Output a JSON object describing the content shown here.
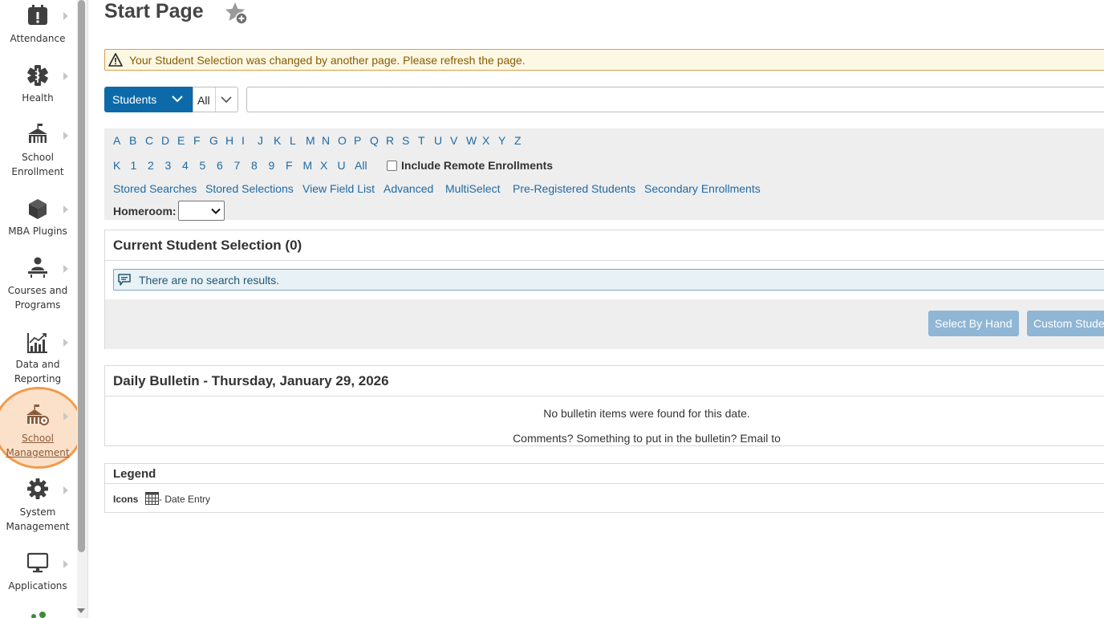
{
  "sidebar": {
    "items": [
      {
        "id": "attendance",
        "label_lines": [
          "Attendance"
        ],
        "icon": "attendance-icon"
      },
      {
        "id": "health",
        "label_lines": [
          "Health"
        ],
        "icon": "health-icon"
      },
      {
        "id": "school-enrollment",
        "label_lines": [
          "School",
          "Enrollment"
        ],
        "icon": "school-icon"
      },
      {
        "id": "mba-plugins",
        "label_lines": [
          "MBA Plugins"
        ],
        "icon": "cube-icon"
      },
      {
        "id": "courses-programs",
        "label_lines": [
          "Courses and",
          "Programs"
        ],
        "icon": "teacher-icon"
      },
      {
        "id": "data-reporting",
        "label_lines": [
          "Data and",
          "Reporting"
        ],
        "icon": "chart-icon"
      },
      {
        "id": "school-management",
        "label_lines": [
          "School",
          "Management"
        ],
        "icon": "school-gear-icon",
        "active": true
      },
      {
        "id": "system-management",
        "label_lines": [
          "System",
          "Management"
        ],
        "icon": "gear-icon"
      },
      {
        "id": "applications",
        "label_lines": [
          "Applications"
        ],
        "icon": "monitor-icon"
      }
    ]
  },
  "header": {
    "title": "Start Page",
    "favorite_icon": "star-add-icon"
  },
  "warning": {
    "text": "Your Student Selection was changed by another page. Please refresh the page.",
    "icon": "warning-icon"
  },
  "search": {
    "type_label": "Students",
    "scope_label": "All",
    "query": ""
  },
  "alpha": {
    "letters": [
      "A",
      "B",
      "C",
      "D",
      "E",
      "F",
      "G",
      "H",
      "I",
      "J",
      "K",
      "L",
      "M",
      "N",
      "O",
      "P",
      "Q",
      "R",
      "S",
      "T",
      "U",
      "V",
      "W",
      "X",
      "Y",
      "Z"
    ],
    "grades": [
      "K",
      "1",
      "2",
      "3",
      "4",
      "5",
      "6",
      "7",
      "8",
      "9",
      "F",
      "M",
      "X",
      "U",
      "All"
    ],
    "remote_label": "Include Remote Enrollments",
    "remote_checked": false
  },
  "links": [
    "Stored Searches",
    "Stored Selections",
    "View Field List",
    "Advanced",
    "MultiSelect",
    "Pre-Registered Students",
    "Secondary Enrollments"
  ],
  "homeroom": {
    "label": "Homeroom:",
    "value": ""
  },
  "selection": {
    "title": "Current Student Selection (0)",
    "info": "There are no search results.",
    "buttons": [
      "Select By Hand",
      "Custom Stude"
    ]
  },
  "bulletin": {
    "title": "Daily Bulletin - Thursday, January 29, 2026",
    "empty_text": "No bulletin items were found for this date.",
    "comments_text": "Comments? Something to put in the bulletin? Email to"
  },
  "legend": {
    "title": "Legend",
    "icons_label": "Icons",
    "date_entry": "- Date Entry"
  }
}
